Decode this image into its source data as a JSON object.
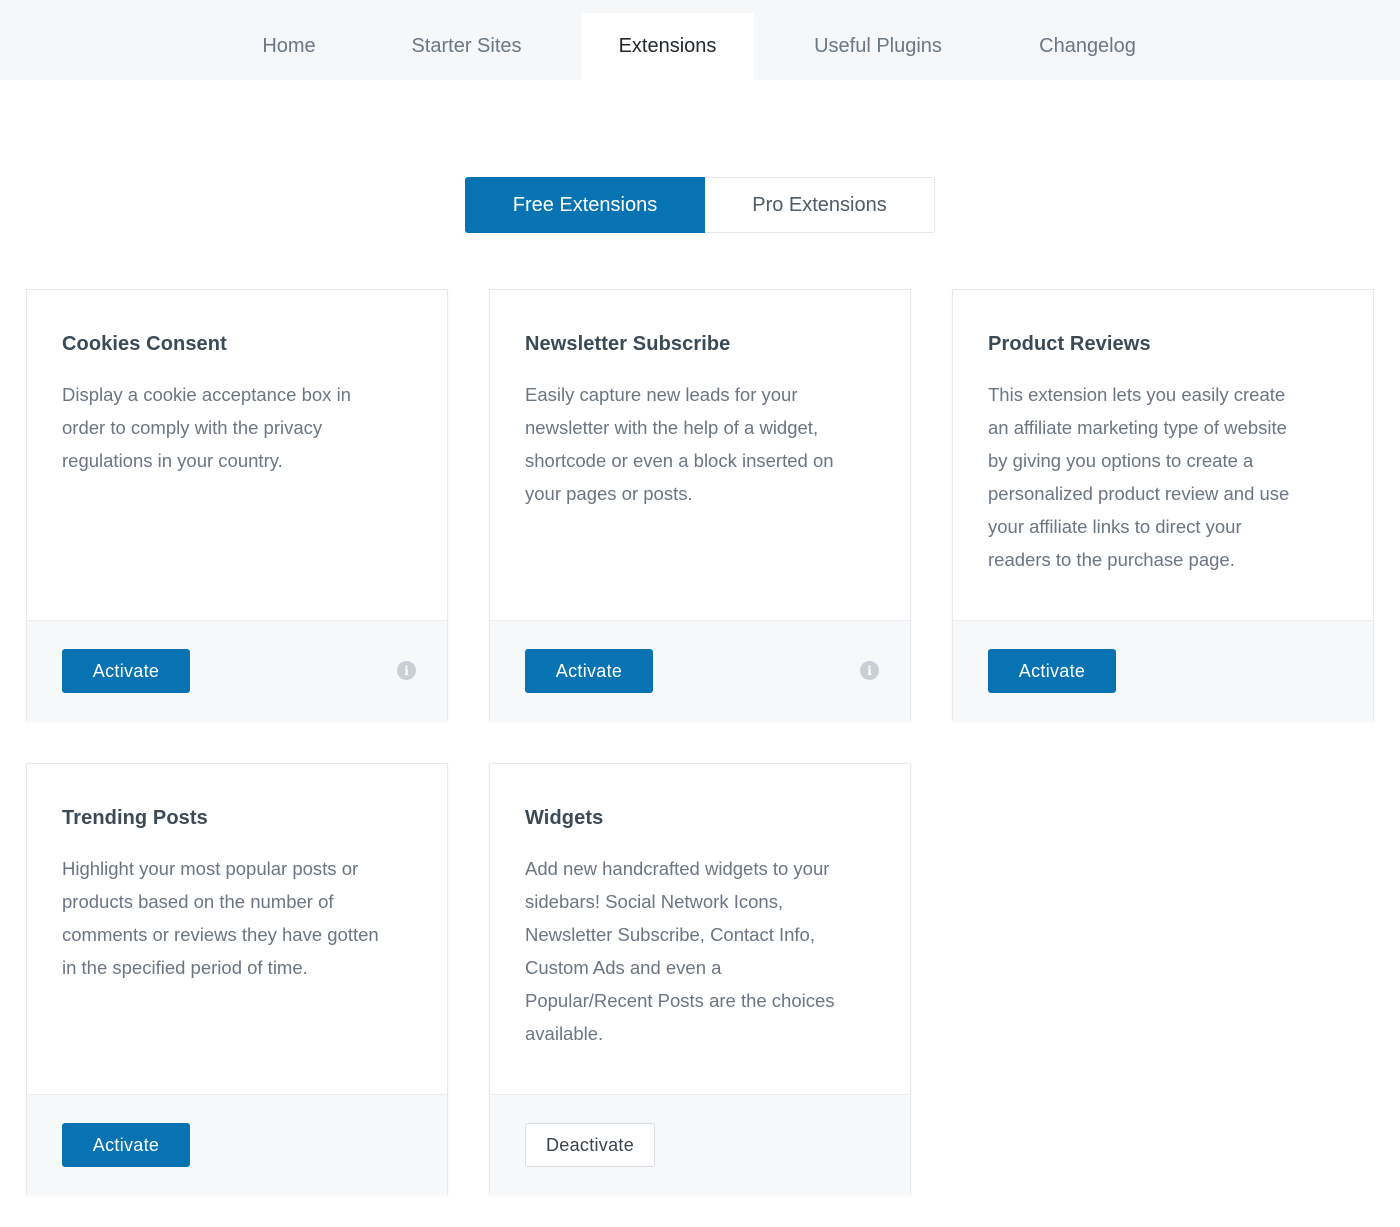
{
  "nav": {
    "tabs": [
      {
        "label": "Home"
      },
      {
        "label": "Starter Sites"
      },
      {
        "label": "Extensions",
        "active": true
      },
      {
        "label": "Useful Plugins"
      },
      {
        "label": "Changelog"
      }
    ]
  },
  "segmented": {
    "free_label": "Free Extensions",
    "pro_label": "Pro Extensions",
    "selected": "Free Extensions"
  },
  "cards": [
    {
      "title": "Cookies Consent",
      "desc_lines": [
        "Display a cookie acceptance box in",
        "order to comply with the privacy",
        "regulations in your country."
      ],
      "button": "Activate",
      "info_icon": true
    },
    {
      "title": "Newsletter Subscribe",
      "desc_lines": [
        "Easily capture new leads for your",
        "newsletter with the help of a widget,",
        "shortcode or even a block inserted on",
        "your pages or posts."
      ],
      "button": "Activate",
      "info_icon": true
    },
    {
      "title": "Product Reviews",
      "desc_lines": [
        "This extension lets you easily create",
        "an affiliate marketing type of website",
        "by giving you options to create a",
        "personalized product review and use",
        "your affiliate links to direct your",
        "readers to the purchase page."
      ],
      "button": "Activate",
      "info_icon": false
    },
    {
      "title": "Trending Posts",
      "desc_lines": [
        "Highlight your most popular posts or",
        "products based on the number of",
        "comments or reviews they have gotten",
        "in the specified period of time."
      ],
      "button": "Activate",
      "info_icon": false
    },
    {
      "title": "Widgets",
      "desc_lines": [
        "Add new handcrafted widgets to your",
        "sidebars! Social Network Icons,",
        "Newsletter Subscribe, Contact Info,",
        "Custom Ads and even a",
        "Popular/Recent Posts are the choices",
        "available."
      ],
      "button": "Deactivate",
      "info_icon": false
    }
  ],
  "colors": {
    "accent": "#0873b3",
    "nav_bg": "#f5f7f9",
    "card_footer_bg": "#f7f8fa"
  },
  "icons": {
    "info": "info-icon"
  }
}
